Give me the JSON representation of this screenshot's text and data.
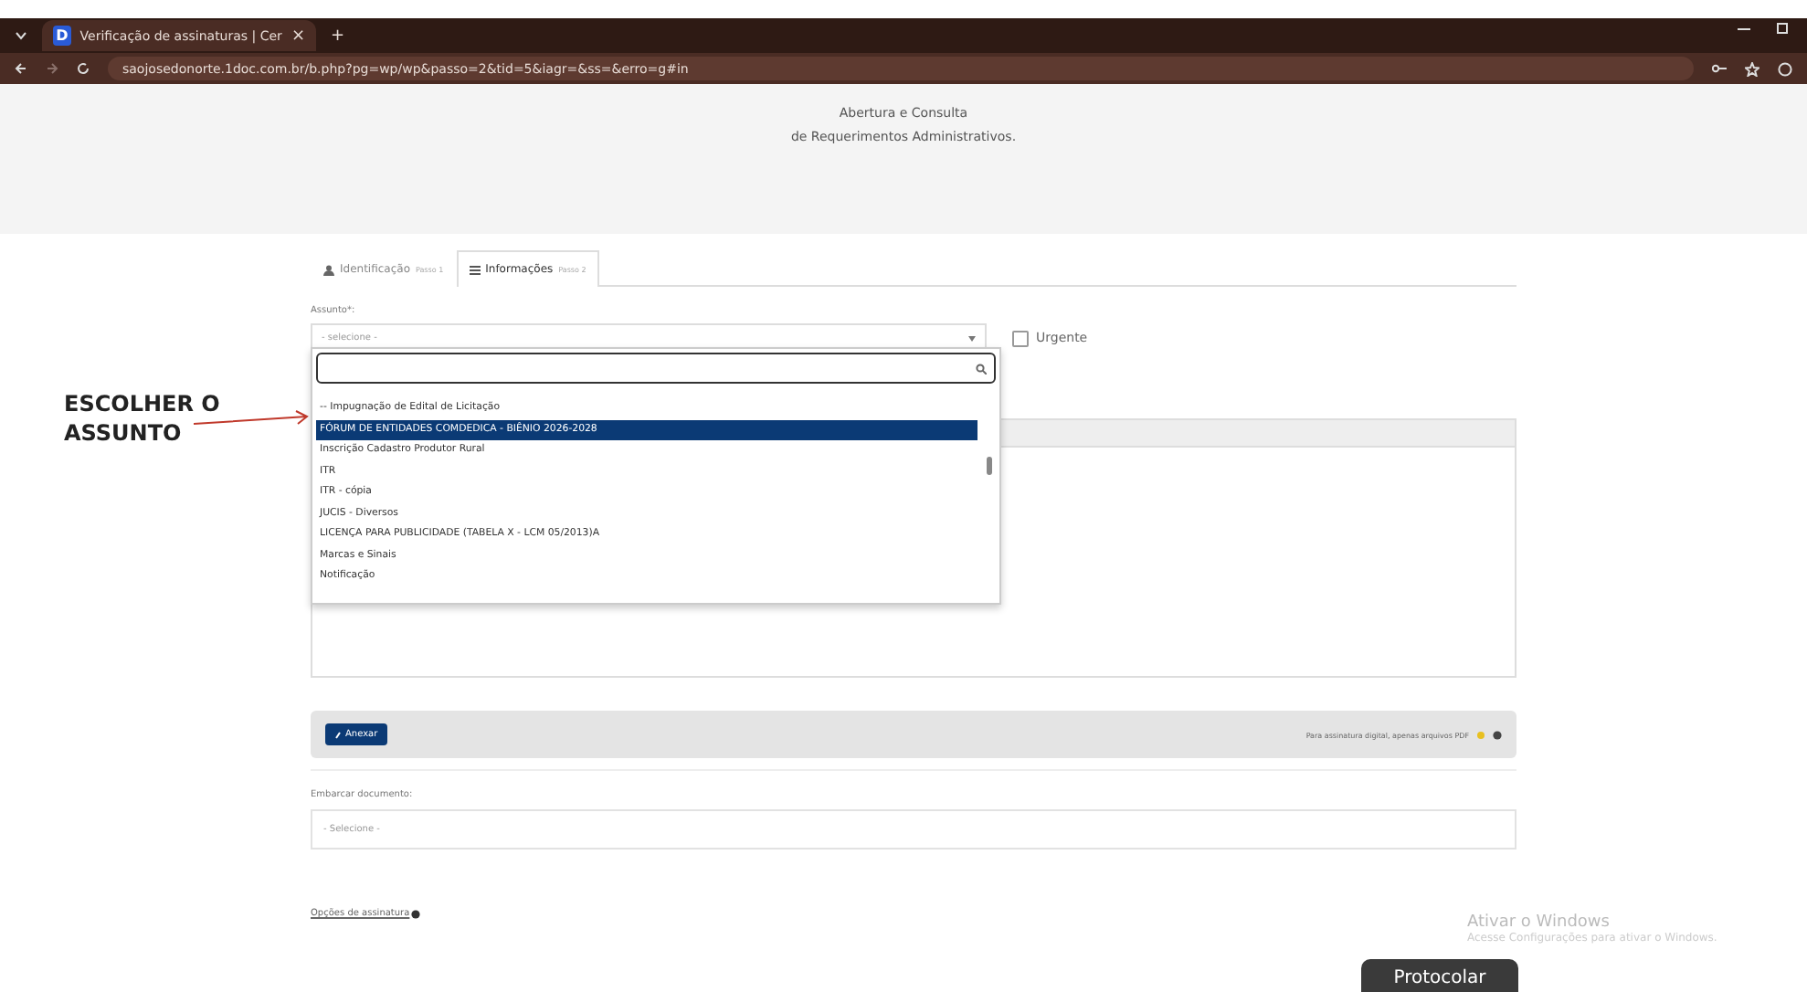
{
  "browser": {
    "tab": {
      "favicon": "D",
      "title": "Verificação de assinaturas | Cer",
      "close": "×"
    },
    "new_tab": "+",
    "url": "saojosedonorte.1doc.com.br/b.php?pg=wp/wp&passo=2&tid=5&iagr=&ss=&erro=g#in"
  },
  "header": {
    "line_1": "Abertura e Consulta",
    "line_2": "de Requerimentos Administrativos."
  },
  "steps": [
    {
      "label": "Identificação",
      "step": "Passo 1",
      "selected": false
    },
    {
      "label": "Informações",
      "step": "Passo 2",
      "selected": true
    }
  ],
  "subject": {
    "label": "Assunto*:",
    "placeholder": "- selecione -",
    "expanded": true
  },
  "urgent": {
    "label": "Urgente",
    "checked": false
  },
  "dropdown": {
    "options": [
      {
        "label": "-- Impugnação de Edital de Licitação",
        "selected": false
      },
      {
        "label": "FÓRUM DE ENTIDADES COMDEDICA - BIÊNIO 2026-2028",
        "selected": true
      },
      {
        "label": "Inscrição Cadastro Produtor Rural",
        "selected": false
      },
      {
        "label": "ITR",
        "selected": false
      },
      {
        "label": "ITR - cópia",
        "selected": false
      },
      {
        "label": "JUCIS - Diversos",
        "selected": false
      },
      {
        "label": "LICENÇA PARA PUBLICIDADE (TABELA X - LCM 05/2013)A",
        "selected": false
      },
      {
        "label": "Marcas e Sinais",
        "selected": false
      },
      {
        "label": "Notificação",
        "selected": false
      }
    ]
  },
  "attach": {
    "button": "Anexar",
    "note": "Para assinatura digital, apenas arquivos PDF"
  },
  "embed": {
    "label": "Embarcar documento:",
    "placeholder": "- Selecione -"
  },
  "signature_options": "Opções de assinatura",
  "submit": "Protocolar",
  "annotation": "ESCOLHER O ASSUNTO",
  "os_notice": {
    "title": "Ativar o Windows",
    "text": "Acesse Configurações para ativar o Windows."
  }
}
